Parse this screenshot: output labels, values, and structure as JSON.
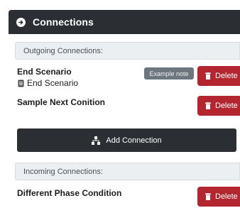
{
  "panel": {
    "title": "Connections"
  },
  "outgoing": {
    "label": "Outgoing Connections:",
    "items": [
      {
        "title": "End Scenario",
        "subtitle": "End Scenario",
        "subtitle_icon": "document-icon",
        "note": "Example note",
        "delete_label": "Delete"
      },
      {
        "title": "Sample Next Conition",
        "delete_label": "Delete"
      }
    ]
  },
  "add_connection": {
    "label": "Add Connection",
    "icon": "sitemap-icon"
  },
  "incoming": {
    "label": "Incoming Connections:",
    "items": [
      {
        "title": "Different Phase Condition",
        "delete_label": "Delete"
      }
    ]
  },
  "colors": {
    "header_bg": "#2b2f33",
    "delete_bg": "#b3262f",
    "badge_bg": "#6d767e",
    "section_bg": "#eceff1"
  }
}
